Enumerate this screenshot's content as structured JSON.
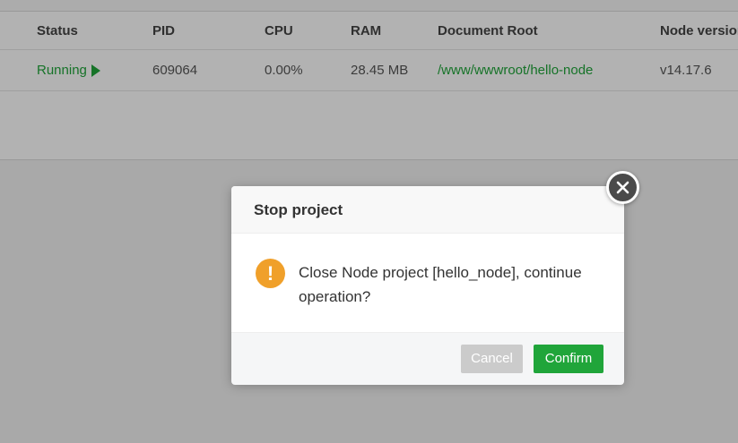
{
  "table": {
    "headers": {
      "status": "Status",
      "pid": "PID",
      "cpu": "CPU",
      "ram": "RAM",
      "root": "Document Root",
      "node": "Node version"
    },
    "row": {
      "status": "Running",
      "pid": "609064",
      "cpu": "0.00%",
      "ram": "28.45 MB",
      "root": "/www/wwwroot/hello-node",
      "node": "v14.17.6"
    }
  },
  "dialog": {
    "title": "Stop project",
    "message": "Close Node project [hello_node], continue operation?",
    "cancel_label": "Cancel",
    "confirm_label": "Confirm",
    "warning_glyph": "!"
  },
  "colors": {
    "accent_green": "#20a53a",
    "warning_orange": "#f0a02a",
    "cancel_gray": "#cbcbcb"
  },
  "icons": {
    "close": "close-icon",
    "warning": "warning-icon",
    "running": "play-icon"
  }
}
